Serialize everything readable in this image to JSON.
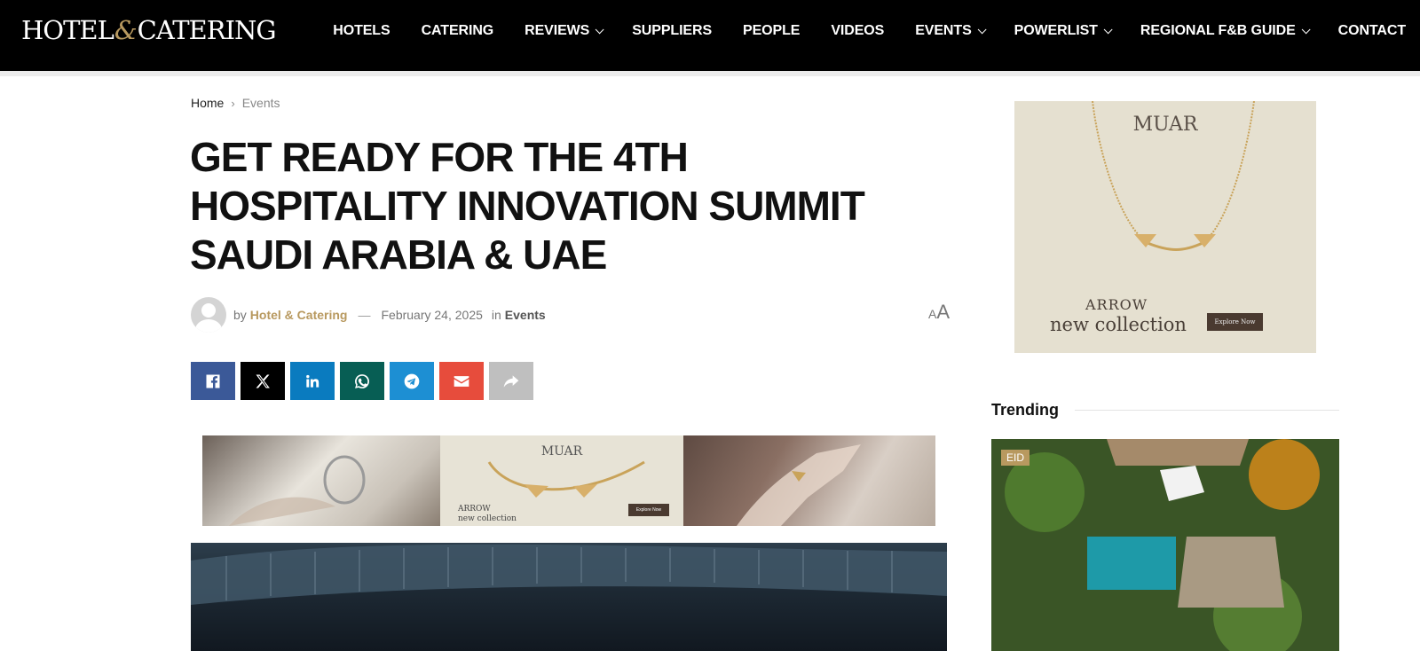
{
  "header": {
    "logo_left": "HOTEL",
    "logo_amp": "&",
    "logo_right": "CATERING",
    "nav": [
      {
        "label": "HOTELS",
        "dropdown": false
      },
      {
        "label": "CATERING",
        "dropdown": false
      },
      {
        "label": "REVIEWS",
        "dropdown": true
      },
      {
        "label": "SUPPLIERS",
        "dropdown": false
      },
      {
        "label": "PEOPLE",
        "dropdown": false
      },
      {
        "label": "VIDEOS",
        "dropdown": false
      },
      {
        "label": "EVENTS",
        "dropdown": true
      },
      {
        "label": "POWERLIST",
        "dropdown": true
      },
      {
        "label": "REGIONAL F&B GUIDE",
        "dropdown": true
      },
      {
        "label": "CONTACT",
        "dropdown": false
      }
    ]
  },
  "breadcrumb": {
    "home": "Home",
    "current": "Events"
  },
  "article": {
    "title": "GET READY FOR THE 4TH HOSPITALITY INNOVATION SUMMIT SAUDI ARABIA & UAE",
    "by": "by",
    "author": "Hotel & Catering",
    "dash": "—",
    "date": "February 24, 2025",
    "in": "in",
    "category": "Events",
    "font_small": "A",
    "font_large": "A"
  },
  "share": [
    {
      "name": "facebook",
      "color": "#3b5998"
    },
    {
      "name": "x",
      "color": "#000000"
    },
    {
      "name": "linkedin",
      "color": "#0a7bbf"
    },
    {
      "name": "whatsapp",
      "color": "#075e54"
    },
    {
      "name": "telegram",
      "color": "#1d8fd3"
    },
    {
      "name": "email",
      "color": "#e74c3c"
    },
    {
      "name": "share",
      "color": "#bfbfbf"
    }
  ],
  "ad_banner": {
    "brand": "MUAR",
    "collection_line1": "ARROW",
    "collection_line2": "new collection",
    "cta": "Explore Now"
  },
  "sidebar_ad": {
    "brand": "MUAR",
    "label": "ARROW",
    "collection": "new collection",
    "cta": "Explore Now"
  },
  "trending": {
    "heading": "Trending",
    "badge": "EID"
  },
  "colors": {
    "accent": "#b8995f",
    "topbar": "#000000"
  }
}
